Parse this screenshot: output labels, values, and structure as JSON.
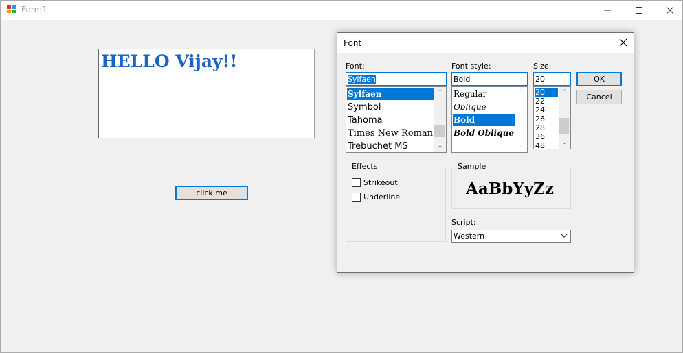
{
  "window": {
    "title": "Form1",
    "minimize_icon": "minimize-icon",
    "maximize_icon": "maximize-icon",
    "close_icon": "close-icon"
  },
  "form": {
    "richtext": "HELLO Vijay!!",
    "richtext_color": "#1a64c8",
    "click_button": "click me"
  },
  "font_dialog": {
    "title": "Font",
    "font_label": "Font:",
    "font_value": "Sylfaen",
    "fonts": [
      "Sylfaen",
      "Symbol",
      "Tahoma",
      "Times New Roman",
      "Trebuchet MS"
    ],
    "selected_font": "Sylfaen",
    "style_label": "Font style:",
    "style_value": "Bold",
    "styles": [
      "Regular",
      "Oblique",
      "Bold",
      "Bold Oblique"
    ],
    "selected_style": "Bold",
    "size_label": "Size:",
    "size_value": "20",
    "sizes": [
      "20",
      "22",
      "24",
      "26",
      "28",
      "36",
      "48"
    ],
    "selected_size": "20",
    "ok": "OK",
    "cancel": "Cancel",
    "effects_label": "Effects",
    "strikeout": "Strikeout",
    "strikeout_checked": false,
    "underline": "Underline",
    "underline_checked": false,
    "sample_label": "Sample",
    "sample_text": "AaBbYyZz",
    "script_label": "Script:",
    "script_value": "Western"
  },
  "colors": {
    "selection": "#0078d7",
    "accent_border": "#0078d7"
  }
}
